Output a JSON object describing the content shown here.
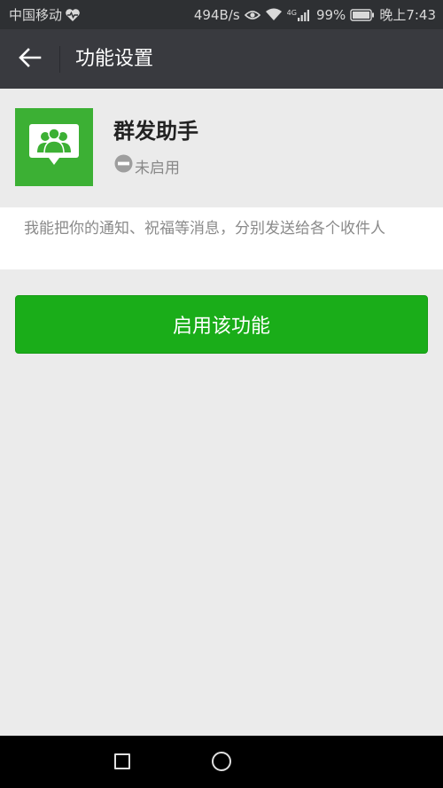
{
  "status_bar": {
    "carrier": "中国移动",
    "health_icon": "heart-pulse-icon",
    "network_speed": "494B/s",
    "eye_icon": "eye-icon",
    "wifi_icon": "wifi-icon",
    "cellular_label": "4G",
    "battery_percent": "99%",
    "time": "晚上7:43"
  },
  "title_bar": {
    "back_icon": "arrow-left-icon",
    "title": "功能设置"
  },
  "feature": {
    "icon": "group-chat-icon",
    "name": "群发助手",
    "status_icon": "minus-circle-icon",
    "status": "未启用",
    "description": "我能把你的通知、祝福等消息，分别发送给各个收件人"
  },
  "actions": {
    "enable_label": "启用该功能"
  },
  "nav_bar": {
    "recents_icon": "square-icon",
    "home_icon": "circle-icon"
  },
  "colors": {
    "accent_green": "#1aad19",
    "logo_green": "#3cb034",
    "title_bar": "#393a3f",
    "status_bar": "#2e3033",
    "background": "#ebebeb"
  }
}
